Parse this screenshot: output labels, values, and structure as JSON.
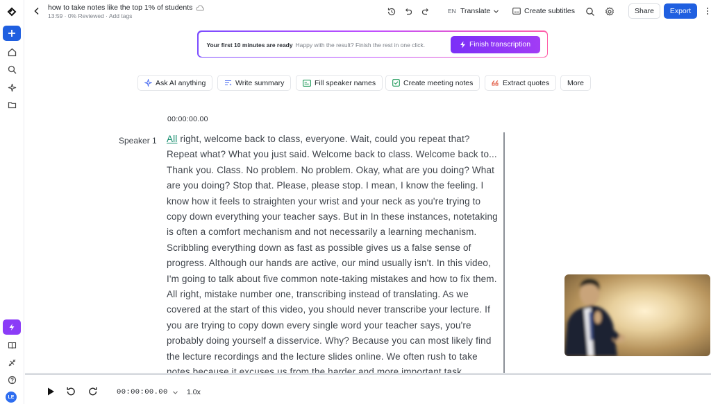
{
  "header": {
    "title": "how to take notes like the top 1% of students",
    "meta": "13:59 · 0% Reviewed · Add tags",
    "lang_code": "EN",
    "translate_label": "Translate",
    "subtitles_label": "Create subtitles",
    "share_label": "Share",
    "export_label": "Export"
  },
  "promo": {
    "strong": "Your first 10 minutes are ready",
    "text": "Happy with the result? Finish the rest in one click.",
    "button": "Finish transcription"
  },
  "chips": [
    {
      "label": "Ask AI anything",
      "icon": "sparkle-icon"
    },
    {
      "label": "Write summary",
      "icon": "summary-icon"
    },
    {
      "label": "Fill speaker names",
      "icon": "id-card-icon"
    },
    {
      "label": "Create meeting notes",
      "icon": "checkbox-icon"
    },
    {
      "label": "Extract quotes",
      "icon": "quote-icon"
    },
    {
      "label": "More",
      "icon": ""
    }
  ],
  "transcript": {
    "timestamp": "00:00:00.00",
    "speaker": "Speaker 1",
    "first_word": "All",
    "text": " right, welcome back to class, everyone. Wait, could you repeat that? Repeat what? What you just said. Welcome back to class. Welcome back to... Thank you. Class. No problem. No problem. Okay, what are you doing? What are you doing? Stop that. Please, please stop. I mean, I know the feeling. I know how it feels to straighten your wrist and your neck as you're trying to copy down everything your teacher says. But in In these instances, notetaking is often a comfort mechanism and not necessarily a learning mechanism. Scribbling everything down as fast as possible gives us a false sense of progress. Although our hands are active, our mind usually isn't. In this video, I'm going to talk about five common note-taking mistakes and how to fix them. All right, mistake number one, transcribing instead of translating. As we covered at the start of this video, you should never transcribe your lecture. If you are trying to copy down every single word your teacher says, you're probably doing yourself a disservice. Why? Because you can most likely find the lecture recordings and the lecture slides online. We often rush to take notes because it excuses us from the harder and more important task."
  },
  "player": {
    "time": "00:00:00.00",
    "speed": "1.0x"
  },
  "rail": {
    "avatar_initials": "LE"
  },
  "colors": {
    "accent": "#1f5fe0",
    "purple": "#8b3cf7",
    "highlight": "#0f8a6a"
  }
}
